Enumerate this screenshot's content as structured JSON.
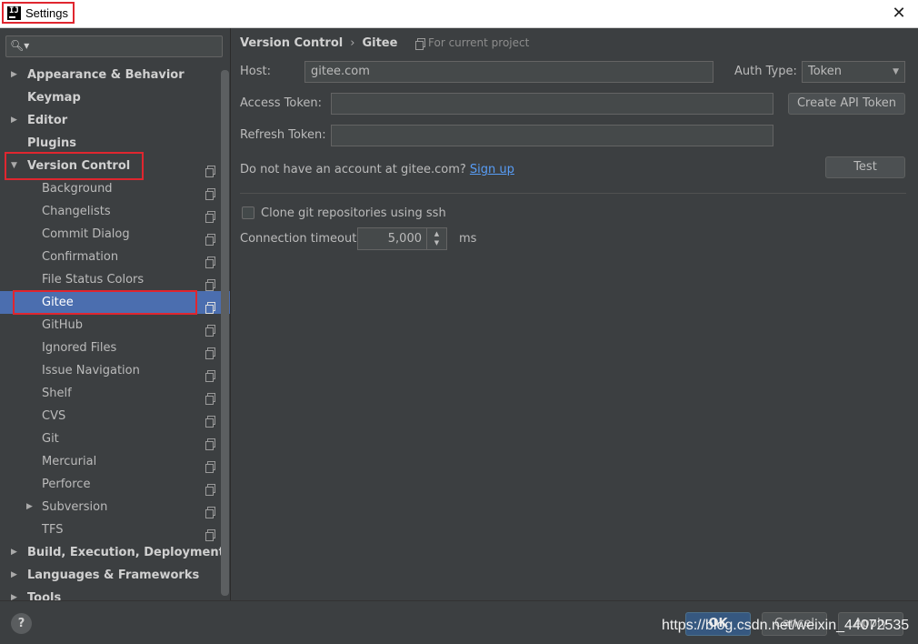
{
  "window": {
    "title": "Settings",
    "close_label": "✕"
  },
  "sidebar": {
    "search_icon": "search-icon",
    "items": [
      {
        "label": "Appearance & Behavior",
        "level": 0,
        "bold": true,
        "arrow": "▶",
        "copy": false
      },
      {
        "label": "Keymap",
        "level": 0,
        "bold": true,
        "arrow": "",
        "copy": false
      },
      {
        "label": "Editor",
        "level": 0,
        "bold": true,
        "arrow": "▶",
        "copy": false
      },
      {
        "label": "Plugins",
        "level": 0,
        "bold": true,
        "arrow": "",
        "copy": false
      },
      {
        "label": "Version Control",
        "level": 0,
        "bold": true,
        "arrow": "▼",
        "copy": true
      },
      {
        "label": "Background",
        "level": 1,
        "bold": false,
        "arrow": "",
        "copy": true
      },
      {
        "label": "Changelists",
        "level": 1,
        "bold": false,
        "arrow": "",
        "copy": true
      },
      {
        "label": "Commit Dialog",
        "level": 1,
        "bold": false,
        "arrow": "",
        "copy": true
      },
      {
        "label": "Confirmation",
        "level": 1,
        "bold": false,
        "arrow": "",
        "copy": true
      },
      {
        "label": "File Status Colors",
        "level": 1,
        "bold": false,
        "arrow": "",
        "copy": true
      },
      {
        "label": "Gitee",
        "level": 1,
        "bold": false,
        "arrow": "",
        "copy": true,
        "selected": true
      },
      {
        "label": "GitHub",
        "level": 1,
        "bold": false,
        "arrow": "",
        "copy": true
      },
      {
        "label": "Ignored Files",
        "level": 1,
        "bold": false,
        "arrow": "",
        "copy": true
      },
      {
        "label": "Issue Navigation",
        "level": 1,
        "bold": false,
        "arrow": "",
        "copy": true
      },
      {
        "label": "Shelf",
        "level": 1,
        "bold": false,
        "arrow": "",
        "copy": true
      },
      {
        "label": "CVS",
        "level": 1,
        "bold": false,
        "arrow": "",
        "copy": true
      },
      {
        "label": "Git",
        "level": 1,
        "bold": false,
        "arrow": "",
        "copy": true
      },
      {
        "label": "Mercurial",
        "level": 1,
        "bold": false,
        "arrow": "",
        "copy": true
      },
      {
        "label": "Perforce",
        "level": 1,
        "bold": false,
        "arrow": "",
        "copy": true
      },
      {
        "label": "Subversion",
        "level": 1,
        "bold": false,
        "arrow": "▶",
        "copy": true
      },
      {
        "label": "TFS",
        "level": 1,
        "bold": false,
        "arrow": "",
        "copy": true
      },
      {
        "label": "Build, Execution, Deployment",
        "level": 0,
        "bold": true,
        "arrow": "▶",
        "copy": false
      },
      {
        "label": "Languages & Frameworks",
        "level": 0,
        "bold": true,
        "arrow": "▶",
        "copy": false
      },
      {
        "label": "Tools",
        "level": 0,
        "bold": true,
        "arrow": "▶",
        "copy": false
      }
    ]
  },
  "content": {
    "breadcrumb": {
      "parent": "Version Control",
      "separator": "›",
      "current": "Gitee"
    },
    "scope_label": "For current project",
    "host": {
      "label": "Host:",
      "value": "gitee.com"
    },
    "auth_type": {
      "label": "Auth Type:",
      "value": "Token"
    },
    "access_token": {
      "label": "Access Token:",
      "value": ""
    },
    "create_token_button": "Create API Token",
    "refresh_token": {
      "label": "Refresh Token:",
      "value": ""
    },
    "account_prompt": "Do not have an account at gitee.com?",
    "sign_up_link": "Sign up",
    "test_button": "Test",
    "clone_ssh": {
      "label": "Clone git repositories using ssh",
      "checked": false
    },
    "timeout": {
      "label": "Connection timeout:",
      "value": "5,000",
      "unit": "ms"
    }
  },
  "footer": {
    "help_label": "?",
    "ok_label": "OK",
    "cancel_label": "Cancel",
    "apply_label": "Apply",
    "watermark": "https://blog.csdn.net/weixin_44072535"
  },
  "colors": {
    "background": "#3c3f41",
    "selection": "#4b6eaf",
    "highlight_box": "#e0262f",
    "link": "#589df6",
    "default_button": "#365880"
  }
}
